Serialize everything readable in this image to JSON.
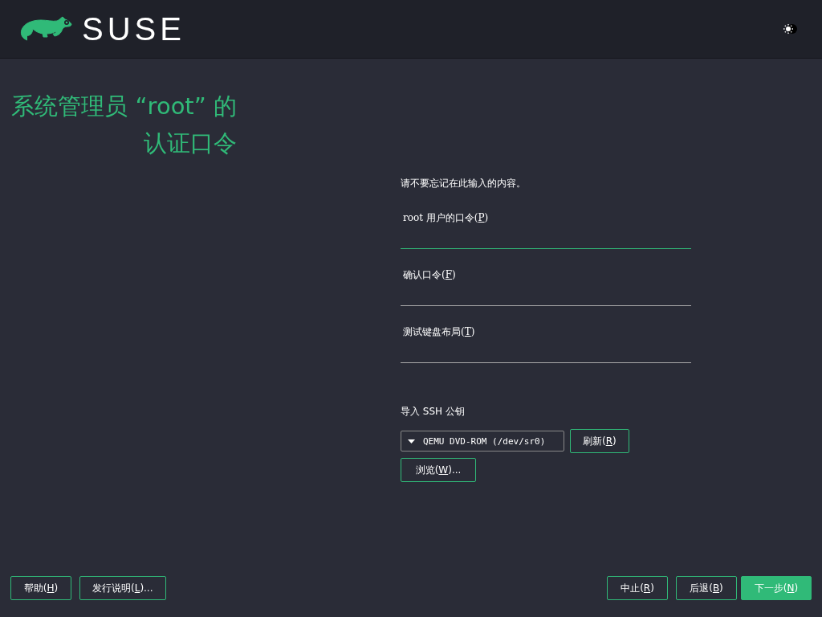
{
  "header": {
    "logo_text": "SUSE"
  },
  "title": {
    "lines": [
      "系统管理员 “root” 的",
      "认证口令"
    ]
  },
  "form": {
    "intro": "请不要忘记在此输入的内容。",
    "fields": [
      {
        "label": {
          "before": "root 用户的口令(",
          "key": "P",
          "after": ")"
        },
        "focused": true
      },
      {
        "label": {
          "before": "确认口令(",
          "key": "F",
          "after": ")"
        },
        "focused": false
      },
      {
        "label": {
          "before": "测试键盘布局(",
          "key": "T",
          "after": ")"
        },
        "focused": false
      }
    ],
    "ssh": {
      "label": "导入 SSH 公钥",
      "device": "QEMU DVD-ROM (/dev/sr0)",
      "refresh": {
        "before": "刷新(",
        "key": "R",
        "after": ")"
      },
      "browse": {
        "before": "浏览(",
        "key": "W",
        "after": ")..."
      }
    }
  },
  "footer": {
    "left": [
      {
        "before": "帮助(",
        "key": "H",
        "after": ")",
        "primary": false
      },
      {
        "before": "发行说明(",
        "key": "L",
        "after": ")...",
        "primary": false
      }
    ],
    "right": [
      {
        "before": "中止(",
        "key": "R",
        "after": ")",
        "primary": false
      },
      {
        "before": "后退(",
        "key": "B",
        "after": ")",
        "primary": false
      },
      {
        "before": "下一步(",
        "key": "N",
        "after": ")",
        "primary": true
      }
    ]
  }
}
